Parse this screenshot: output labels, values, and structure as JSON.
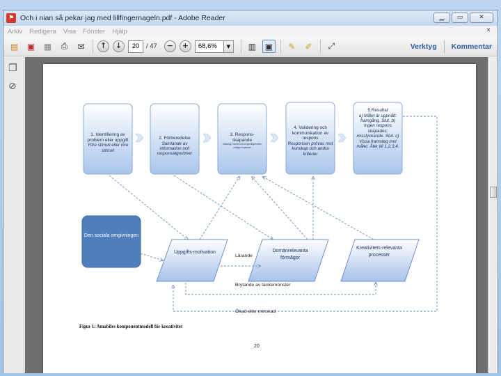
{
  "window": {
    "title": "Och i nian så pekar jag med lillfingernageln.pdf - Adobe Reader",
    "app_icon": "pdf-icon"
  },
  "menu": {
    "items": [
      "Arkiv",
      "Redigera",
      "Visa",
      "Fönster",
      "Hjälp"
    ],
    "close": "×"
  },
  "toolbar": {
    "page_current": "20",
    "page_total": "/ 47",
    "zoom": "68,6%",
    "tools_label": "Verktyg",
    "comment_label": "Kommentar"
  },
  "diagram": {
    "boxes": [
      {
        "title": "1. Identifiering av problem eller uppgift",
        "sub": "Yttre stimuli eller inre stimuli"
      },
      {
        "title": "2. Förberedelse",
        "sub": "Samlande av information och responsalgoritmer"
      },
      {
        "title": "3. Respons-skapande",
        "sub": "Sökning i minnet och omgivningen efter möjliga responser"
      },
      {
        "title": "4. Validering och kommunikation av respons",
        "sub": "Responsen prövas mot kunskap och andra kriterier"
      },
      {
        "title": "5.Resultat",
        "sub": "a) Målet är uppnått: framgång. Slut. b) Ingen respons skapades: misslyckande. Slut. c) Vissa framsteg mot målet. Åter till 1,2,3,4."
      }
    ],
    "social": "Den sociala omgivningen",
    "components": [
      "Uppgifts-motivation",
      "Domänrelevanta förmågor",
      "Kreativitets-relevanta processer"
    ],
    "labels": {
      "learning": "Lärande",
      "breaking": "Brytande av tankemönster",
      "increased": "Ökad eller minskad"
    },
    "caption": "Figur 1: Amabiles komponentmodell för kreativitet",
    "page_number": "20"
  }
}
